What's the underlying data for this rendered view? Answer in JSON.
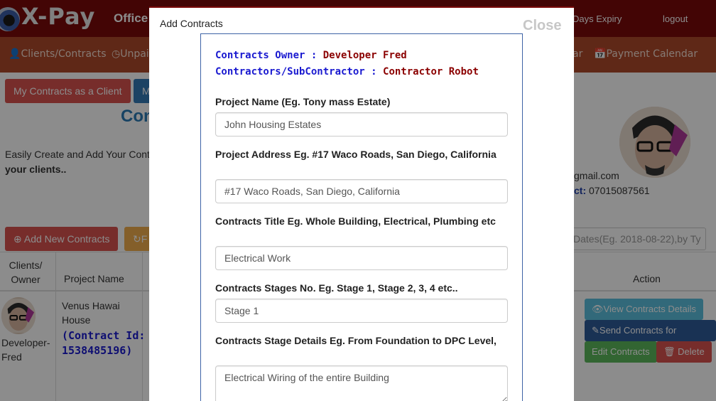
{
  "app": {
    "logo": "X-Pay",
    "office": "Office",
    "expiry": "Days Expiry",
    "logout": "logout"
  },
  "nav": {
    "clients": "Clients/Contracts",
    "unpaid": "Unpai",
    "calendar_partial": "ar",
    "payment_calendar": "Payment Calendar"
  },
  "page": {
    "tab_client": "My Contracts as a Client",
    "tab_partial": "M",
    "title_partial": "Con",
    "intro": "Easily Create and Add Your Cont",
    "intro_bold": "your clients..",
    "email": "gmail.com",
    "contact_label": "ct:",
    "contact_value": "07015087561",
    "add_button": "Add New Contracts",
    "refresh_partial": "F",
    "search_placeholder": "Dates(Eg. 2018-08-22),by Ty"
  },
  "table": {
    "headers": {
      "owner": "Clients/ Owner",
      "project": "Project Name",
      "action": "Action"
    },
    "row": {
      "owner": "Developer- Fred",
      "project": "Venus Hawai House",
      "contract_id": "(Contract Id: 1538485196)",
      "actions": {
        "view": "View Contracts Details",
        "send": "Send Contracts for Review",
        "edit": "Edit Contracts",
        "delete": "Delete"
      }
    }
  },
  "modal": {
    "title": "Add Contracts",
    "close": "Close",
    "owner_label": "Contracts Owner :",
    "owner_value": "Developer Fred",
    "contractor_label": "Contractors/SubContractor :",
    "contractor_value": "Contractor Robot",
    "fields": {
      "project_name": {
        "label": "Project Name (Eg. Tony mass Estate)",
        "value": "John Housing Estates"
      },
      "project_address": {
        "label": "Project Address Eg. #17 Waco Roads, San Diego, California",
        "value": "#17 Waco Roads, San Diego, California"
      },
      "contracts_title": {
        "label": "Contracts Title Eg. Whole Building, Electrical, Plumbing etc",
        "value": "Electrical Work"
      },
      "stages_no": {
        "label": "Contracts Stages No. Eg. Stage 1, Stage 2, 3, 4 etc..",
        "value": "Stage 1"
      },
      "stage_details": {
        "label": "Contracts Stage Details Eg. From Foundation to DPC Level,",
        "value": "Electrical Wiring of the entire Building"
      }
    }
  },
  "colors": {
    "topbar": "#7a0a0a",
    "navbar": "#ad4a2a",
    "owner_label": "#1a1ad0",
    "owner_value": "#8b0000",
    "form_border": "#3d63a6"
  }
}
